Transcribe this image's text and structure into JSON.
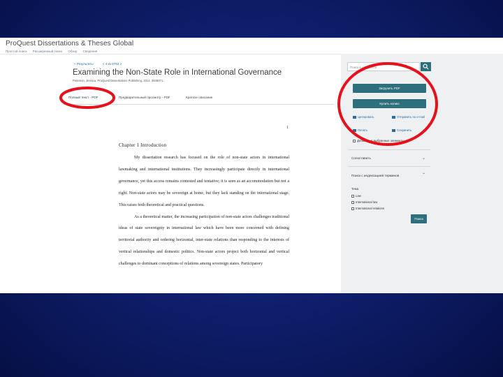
{
  "app": {
    "brand": "ProQuest Dissertations & Theses Global",
    "nav": [
      "Простой поиск",
      "Расширенный поиск",
      "Обзор",
      "Сведения"
    ]
  },
  "doc": {
    "breadcrumbs": [
      "< Результаты",
      "< 4 из 6793 >"
    ],
    "title": "Examining the Non-State Role in International Governance",
    "meta": "Peterson, Jessica. ProQuest Dissertations Publishing, 2014. 3648071.",
    "tabs": [
      "Полный текст - PDF",
      "Предварительный просмотр - PDF",
      "Краткое описание"
    ]
  },
  "page": {
    "number": "1",
    "chapter": "Chapter 1 Introduction",
    "paragraphs": [
      "My dissertation research has focused on the role of non-state actors in international lawmaking and international institutions. They increasingly participate directly in international governance, yet this access remains contested and tentative; it is seen as an accommodation but not a right. Non-state actors may be sovereign at home, but they lack standing on the international stage. This raises both theoretical and practical questions.",
      "As a theoretical matter, the increasing participation of non-state actors challenges traditional ideas of state sovereignty in international law which have been more concerned with defining territorial authority and ordering horizontal, inter-state relations than responding to the interests of vertical relationships and domestic politics. Non-state actors project both horizontal and vertical challenges to dominant conceptions of relations among sovereign states. Participatory"
    ]
  },
  "sidebar": {
    "search_placeholder": "Поиск в документе",
    "download_label": "Загрузить PDF",
    "buy_label": "Купить копию",
    "actions": [
      "Цитировать",
      "Отправить по e-mail",
      "Печать",
      "Сохранить"
    ],
    "add_selected": "Добавить в выбранные элементы",
    "panel1_header": "Сопоставить",
    "panel2_header": "Поиск с индексацией терминов",
    "subject_label": "Тема",
    "subjects": [
      "Law",
      "International law",
      "International relations"
    ],
    "search_button": "Поиск"
  },
  "colors": {
    "accent": "#2d6f7c",
    "link": "#2b6aa3",
    "annotation": "#e8101a"
  }
}
